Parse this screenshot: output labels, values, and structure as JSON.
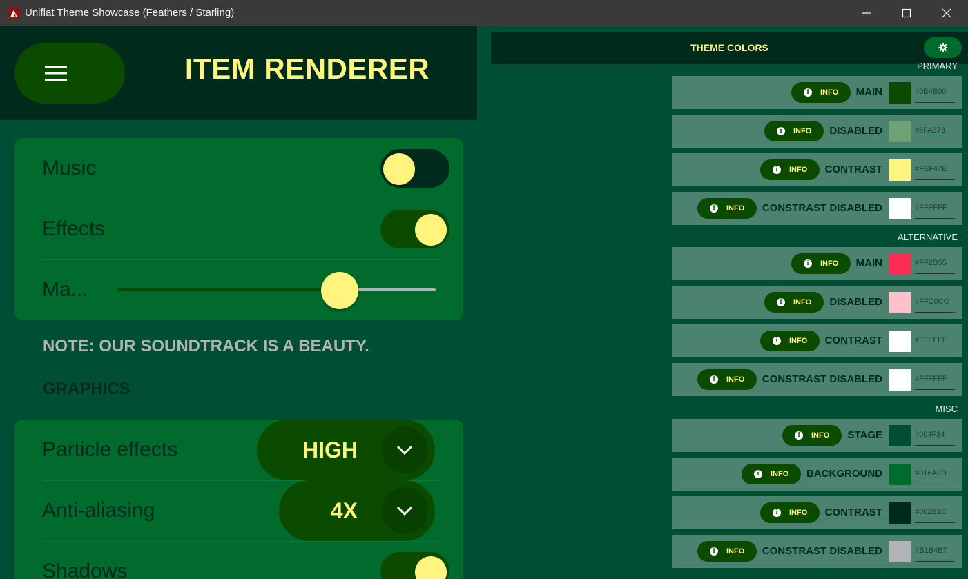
{
  "window": {
    "title": "Uniflat Theme Showcase (Feathers / Starling)",
    "icon": "app-logo-icon"
  },
  "header": {
    "title": "ITEM RENDERER"
  },
  "audio": {
    "music": {
      "label": "Music",
      "on": false
    },
    "effects": {
      "label": "Effects",
      "on": true
    },
    "master": {
      "label": "Ma...",
      "value": 0.7
    }
  },
  "note": "NOTE: OUR SOUNDTRACK IS A BEAUTY.",
  "graphics_heading": "GRAPHICS",
  "graphics": {
    "particle_effects": {
      "label": "Particle effects",
      "value": "HIGH"
    },
    "anti_aliasing": {
      "label": "Anti-aliasing",
      "value": "4X"
    },
    "shadows": {
      "label": "Shadows",
      "on": true
    }
  },
  "theme_panel": {
    "title": "THEME COLORS",
    "info_label": "INFO",
    "groups": [
      {
        "label": "PRIMARY",
        "colors": [
          {
            "name": "MAIN",
            "hex": "#0B4B00"
          },
          {
            "name": "DISABLED",
            "hex": "#6FA373"
          },
          {
            "name": "CONTRAST",
            "hex": "#FEF47E"
          },
          {
            "name": "CONSTRAST DISABLED",
            "hex": "#FFFFFF"
          }
        ]
      },
      {
        "label": "ALTERNATIVE",
        "colors": [
          {
            "name": "MAIN",
            "hex": "#FF2D55"
          },
          {
            "name": "DISABLED",
            "hex": "#FFC0CC"
          },
          {
            "name": "CONTRAST",
            "hex": "#FFFFFF"
          },
          {
            "name": "CONSTRAST DISABLED",
            "hex": "#FFFFFF"
          }
        ]
      },
      {
        "label": "MISC",
        "colors": [
          {
            "name": "STAGE",
            "hex": "#004F34"
          },
          {
            "name": "BACKGROUND",
            "hex": "#016A2D"
          },
          {
            "name": "CONTRAST",
            "hex": "#002B1C"
          },
          {
            "name": "CONSTRAST DISABLED",
            "hex": "#B1B4B7"
          }
        ]
      }
    ]
  }
}
